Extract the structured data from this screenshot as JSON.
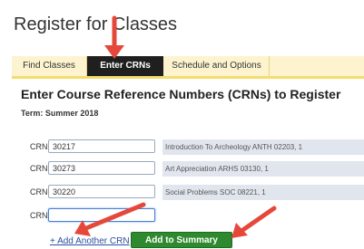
{
  "page_title": "Register for Classes",
  "tabs": [
    {
      "label": "Find Classes",
      "active": false
    },
    {
      "label": "Enter CRNs",
      "active": true
    },
    {
      "label": "Schedule and Options",
      "active": false
    }
  ],
  "heading": "Enter Course Reference Numbers (CRNs) to Register",
  "term": "Term: Summer 2018",
  "crn_label": "CRN",
  "crn_rows": [
    {
      "value": "30217",
      "description": "Introduction To Archeology ANTH 02203, 1"
    },
    {
      "value": "30273",
      "description": "Art Appreciation ARHS 03130, 1"
    },
    {
      "value": "30220",
      "description": "Social Problems SOC 08221, 1"
    },
    {
      "value": "",
      "description": ""
    }
  ],
  "add_crn_link": "+ Add Another CRN",
  "add_summary_button": "Add to Summary",
  "colors": {
    "annotation_arrow": "#e5483a",
    "active_tab_bg": "#1f1f1f",
    "button_green": "#2f8a2f",
    "tab_bar_bg": "#fdf3cf"
  }
}
